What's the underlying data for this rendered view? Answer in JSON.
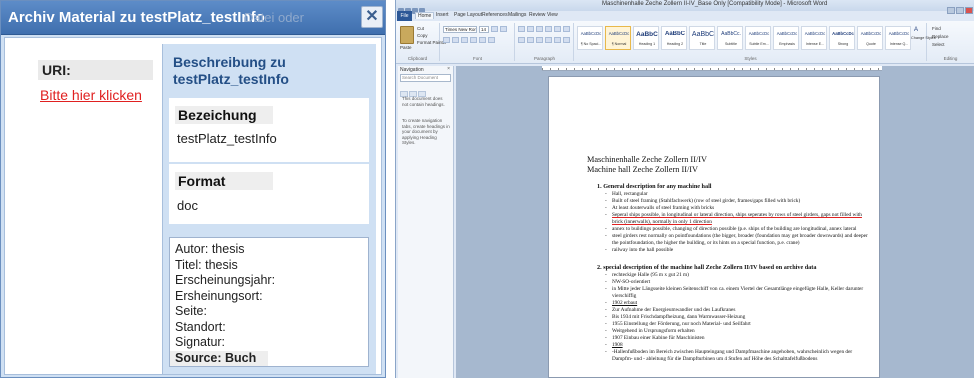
{
  "dialog": {
    "title": "Archiv Material zu testPlatz_testInfo",
    "title_ghost": "Datei oder",
    "close_label": "✕",
    "uri_label": "URI:",
    "link_text": "Bitte hier klicken",
    "desc_heading": "Beschreibung zu testPlatz_testInfo",
    "bezeichnung_label": "Bezeichung",
    "bezeichnung_value": "testPlatz_testInfo",
    "format_label": "Format",
    "format_value": "doc",
    "meta": [
      "Autor: thesis",
      "Titel: thesis",
      "Erscheinungsjahr:",
      "Ersheinungsort:",
      "Seite:",
      "Standort:",
      "Signatur:"
    ],
    "source": "Source: Buch"
  },
  "word": {
    "title": "Maschinenhalle Zeche Zollern II-IV_Base Only [Compatibility Mode] - Microsoft Word",
    "file_tab": "File",
    "tabs": [
      "Home",
      "Insert",
      "Page Layout",
      "References",
      "Mailings",
      "Review",
      "View"
    ],
    "ribbon": {
      "paste": "Paste",
      "cut": "Cut",
      "copy": "Copy",
      "format_painter": "Format Painter",
      "font_name": "Times New Roma",
      "font_size": "14",
      "groups": [
        "Clipboard",
        "Font",
        "Paragraph",
        "Styles",
        "Editing"
      ],
      "styles": [
        {
          "sample": "AaBbCcDc",
          "name": "¶ No Spaci..."
        },
        {
          "sample": "AaBbCcDc",
          "name": "¶ Normal"
        },
        {
          "sample": "AaBbC",
          "name": "Heading 1"
        },
        {
          "sample": "AaBbC",
          "name": "Heading 2"
        },
        {
          "sample": "AaBbC",
          "name": "Title"
        },
        {
          "sample": "AaBbCc.",
          "name": "Subtitle"
        },
        {
          "sample": "AaBbCcDc",
          "name": "Subtle Em..."
        },
        {
          "sample": "AaBbCcDc",
          "name": "Emphasis"
        },
        {
          "sample": "AaBbCcDc",
          "name": "Intense E..."
        },
        {
          "sample": "AaBbCcDc",
          "name": "Strong"
        },
        {
          "sample": "AaBbCcDc",
          "name": "Quote"
        },
        {
          "sample": "AaBbCcDc",
          "name": "Intense Q..."
        }
      ],
      "change_styles": "Change Styles",
      "find": "Find",
      "replace": "Replace",
      "select": "Select"
    },
    "navigation": {
      "title": "Navigation",
      "search_placeholder": "Search Document",
      "text1": "This document does not contain headings.",
      "text2": "To create navigation tabs, create headings in your document by applying Heading Styles."
    },
    "page": {
      "title1": "Maschinenhalle Zeche Zollern II/IV",
      "title2": "Machine hall Zeche Zollern II/IV",
      "h1_prefix": "1.  ",
      "h1": "General description for any machine hall",
      "list1": [
        "Hall, rectangular",
        "Built of steel framing (Stahlfachwerk) (row of steel girder, frames/gaps filled with brick)",
        "At least 4outerwalls of steel framing with bricks",
        "Seperal ships possible, in longitudinal or lateral direction, ships seperates by rows of steel girders, gaps not filled with brick (innerwalls), normally in only 1 direction",
        "annex to buildings possible, changing of direction possible (p.e. ships of the building are longitudinal, annex lateral",
        "steel girders rest normally on pointfoundations (the bigger, broader (foundation may get broader downwards) and deeper the pointfoundation, the higher the building, or its hints on a special function, p.e. crane)",
        "railway into the hall possible"
      ],
      "h2_prefix": "2.  ",
      "h2": "special description of the machine hall Zeche Zollern II/IV  based on archive data",
      "list2": [
        "rechteckige Halle (95 m x gut 21 m)",
        "NW-SO-orientiert",
        "in Mitte jeder Längsseite kleinen Seitenschiff von ca. einem Viertel der Gesamtlänge eingefügte Halle, Keller darunter vierschiffig",
        "1902 erbaut",
        "Zur Aufnahme der Energieumwandler und des Laufkranes",
        "Bis 1934 mit Frischdampfheizung, dann Warmwasser-Heizung",
        "1955 Einstellung der Förderung, nur noch Material- und Seilfahrt",
        "Weitgehend in Ursprungsform erhalten",
        "1907 Einbau einer Kabine für Maschinisten",
        "1908",
        "-Hallenfußboden im Bereich zwischen Haupteingang und Dampfmaschine angehoben, wahrscheinlich wegen der Dampfm- und - ableitung für die Dampfturbinen um 4 Stufen auf Höhe des Schalttafelfußbodens"
      ]
    }
  }
}
